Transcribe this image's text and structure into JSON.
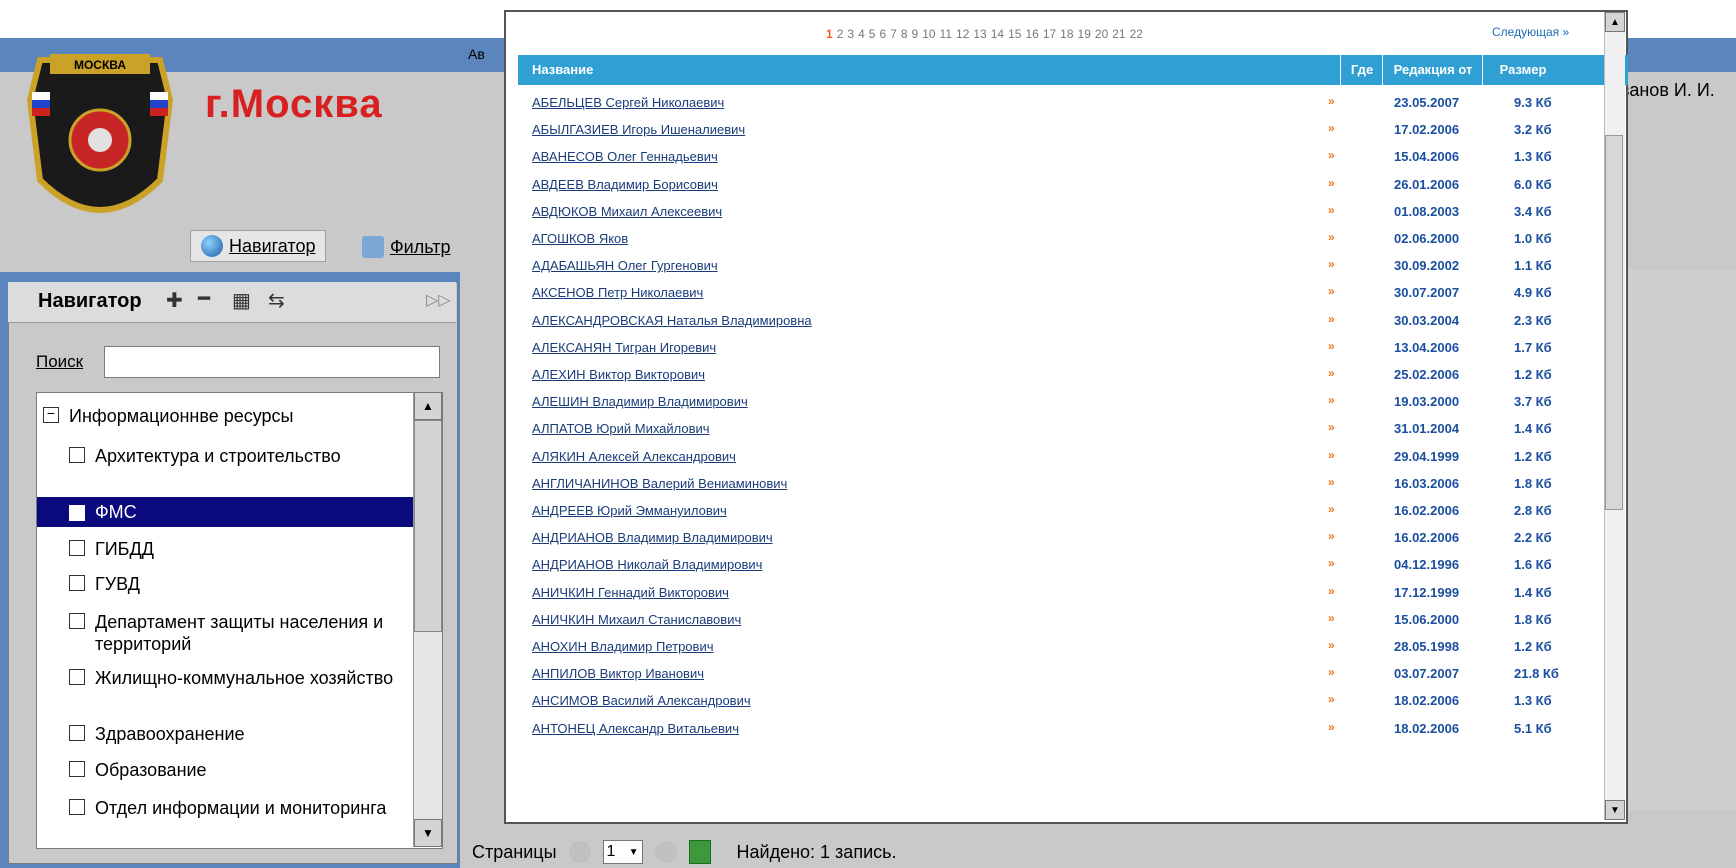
{
  "app": {
    "titlebar_text": "Ав",
    "city_title": "г.Москва",
    "emblem_text": "МОСКВА",
    "user_name": "ванов И. И."
  },
  "toolbar": {
    "navigator_label": "Навигатор",
    "filter_label": "Фильтр"
  },
  "navigator": {
    "title": "Навигатор",
    "search_label": "Поиск",
    "search_value": "",
    "root_label": "Информационнве ресурсы",
    "items": [
      {
        "label": "Архитектура и строительство",
        "selected": false
      },
      {
        "label": "ФМС",
        "selected": true
      },
      {
        "label": "ГИБДД",
        "selected": false
      },
      {
        "label": "ГУВД",
        "selected": false
      },
      {
        "label": "Департамент защиты населения и территорий",
        "selected": false
      },
      {
        "label": "Жилищно-коммунальное хозяйство",
        "selected": false
      },
      {
        "label": "Здравоохранение",
        "selected": false
      },
      {
        "label": "Образование",
        "selected": false
      },
      {
        "label": "Отдел информации и мониторинга",
        "selected": false
      }
    ]
  },
  "status": {
    "pages_label": "Страницы",
    "page_value": "1",
    "found_text": "Найдено: 1 запись."
  },
  "popup": {
    "pages": [
      "1",
      "2",
      "3",
      "4",
      "5",
      "6",
      "7",
      "8",
      "9",
      "10",
      "11",
      "12",
      "13",
      "14",
      "15",
      "16",
      "17",
      "18",
      "19",
      "20",
      "21",
      "22"
    ],
    "current_page": "1",
    "next_label": "Следующая »",
    "columns": {
      "name": "Название",
      "where": "Где",
      "edition": "Редакция от",
      "size": "Размер"
    },
    "rows": [
      {
        "name": "АБЕЛЬЦЕВ Сергей Николаевич",
        "date": "23.05.2007",
        "size": "9.3 Кб"
      },
      {
        "name": "АБЫЛГАЗИЕВ Игорь Ишеналиевич",
        "date": "17.02.2006",
        "size": "3.2 Кб"
      },
      {
        "name": "АВАНЕСОВ Олег Геннадьевич",
        "date": "15.04.2006",
        "size": "1.3 Кб"
      },
      {
        "name": "АВДЕЕВ Владимир Борисович",
        "date": "26.01.2006",
        "size": "6.0 Кб"
      },
      {
        "name": "АВДЮКОВ Михаил Алексеевич",
        "date": "01.08.2003",
        "size": "3.4 Кб"
      },
      {
        "name": "АГОШКОВ Яков",
        "date": "02.06.2000",
        "size": "1.0 Кб"
      },
      {
        "name": "АДАБАШЬЯН Олег Гургенович",
        "date": "30.09.2002",
        "size": "1.1 Кб"
      },
      {
        "name": "АКСЕНОВ Петр Николаевич",
        "date": "30.07.2007",
        "size": "4.9 Кб"
      },
      {
        "name": "АЛЕКСАНДРОВСКАЯ Наталья Владимировна",
        "date": "30.03.2004",
        "size": "2.3 Кб"
      },
      {
        "name": "АЛЕКСАНЯН Тигран Игоревич",
        "date": "13.04.2006",
        "size": "1.7 Кб"
      },
      {
        "name": "АЛЕХИН Виктор Викторович",
        "date": "25.02.2006",
        "size": "1.2 Кб"
      },
      {
        "name": "АЛЕШИН Владимир Владимирович",
        "date": "19.03.2000",
        "size": "3.7 Кб"
      },
      {
        "name": "АЛПАТОВ Юрий Михайлович",
        "date": "31.01.2004",
        "size": "1.4 Кб"
      },
      {
        "name": "АЛЯКИН Алексей Александрович",
        "date": "29.04.1999",
        "size": "1.2 Кб"
      },
      {
        "name": "АНГЛИЧАНИНОВ Валерий Вениаминович",
        "date": "16.03.2006",
        "size": "1.8 Кб"
      },
      {
        "name": "АНДРЕЕВ Юрий Эммануилович",
        "date": "16.02.2006",
        "size": "2.8 Кб"
      },
      {
        "name": "АНДРИАНОВ Владимир Владимирович",
        "date": "16.02.2006",
        "size": "2.2 Кб"
      },
      {
        "name": "АНДРИАНОВ Николай Владимирович",
        "date": "04.12.1996",
        "size": "1.6 Кб"
      },
      {
        "name": "АНИЧКИН Геннадий Викторович",
        "date": "17.12.1999",
        "size": "1.4 Кб"
      },
      {
        "name": "АНИЧКИН Михаил Станиславович",
        "date": "15.06.2000",
        "size": "1.8 Кб"
      },
      {
        "name": "АНОХИН Владимир Петрович",
        "date": "28.05.1998",
        "size": "1.2 Кб"
      },
      {
        "name": "АНПИЛОВ Виктор Иванович",
        "date": "03.07.2007",
        "size": "21.8 Кб"
      },
      {
        "name": "АНСИМОВ Василий Александрович",
        "date": "18.02.2006",
        "size": "1.3 Кб"
      },
      {
        "name": "АНТОНЕЦ Александр Витальевич",
        "date": "18.02.2006",
        "size": "5.1 Кб"
      }
    ]
  }
}
